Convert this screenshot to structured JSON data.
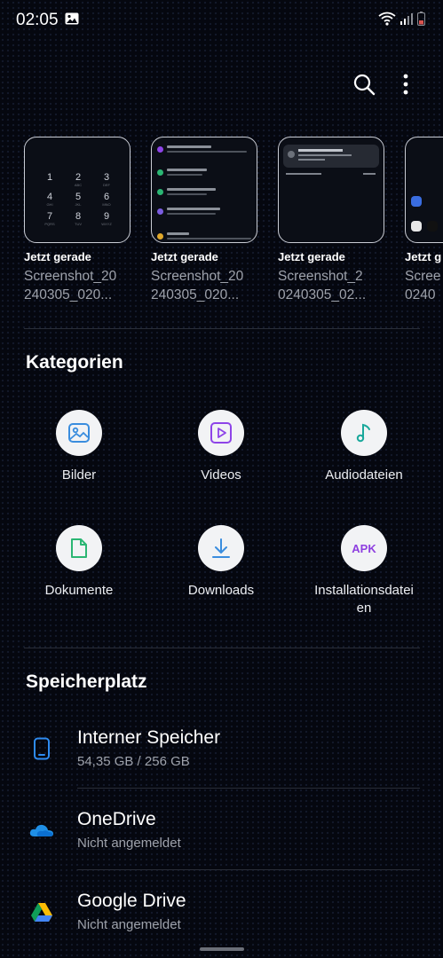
{
  "status": {
    "time": "02:05"
  },
  "recent": [
    {
      "title": "Jetzt gerade",
      "name1": "Screenshot_20",
      "name2": "240305_020..."
    },
    {
      "title": "Jetzt gerade",
      "name1": "Screenshot_20",
      "name2": "240305_020..."
    },
    {
      "title": "Jetzt gerade",
      "name1": "Screenshot_2",
      "name2": "0240305_02..."
    },
    {
      "title": "Jetzt g",
      "name1": "Scree",
      "name2": "0240"
    }
  ],
  "categories": {
    "title": "Kategorien",
    "items": [
      {
        "label": "Bilder",
        "icon": "image-icon"
      },
      {
        "label": "Videos",
        "icon": "video-icon"
      },
      {
        "label": "Audiodateien",
        "icon": "music-note-icon"
      },
      {
        "label": "Dokumente",
        "icon": "document-icon"
      },
      {
        "label": "Downloads",
        "icon": "download-icon"
      },
      {
        "label": "Installationsdatei",
        "label2": "en",
        "icon": "apk-icon",
        "icon_text": "APK"
      }
    ]
  },
  "storage": {
    "title": "Speicherplatz",
    "items": [
      {
        "title": "Interner Speicher",
        "subtitle": "54,35 GB / 256 GB",
        "icon": "phone-icon"
      },
      {
        "title": "OneDrive",
        "subtitle": "Nicht angemeldet",
        "icon": "onedrive-icon"
      },
      {
        "title": "Google Drive",
        "subtitle": "Nicht angemeldet",
        "icon": "google-drive-icon"
      }
    ]
  },
  "colors": {
    "background": "#05070f",
    "accent_blue": "#3a8dde",
    "video_purple": "#8e44e8",
    "audio_teal": "#1aa89b",
    "doc_green": "#2bb673",
    "apk_purple": "#8e3fe0"
  }
}
